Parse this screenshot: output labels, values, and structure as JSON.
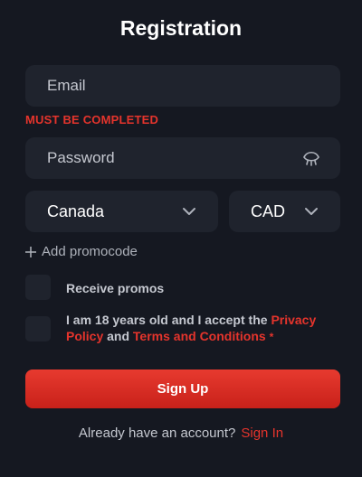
{
  "form": {
    "title": "Registration",
    "email_placeholder": "Email",
    "email_error": "MUST BE COMPLETED",
    "password_placeholder": "Password",
    "country_value": "Canada",
    "currency_value": "CAD",
    "add_promocode": "Add promocode",
    "receive_promos": "Receive promos",
    "terms_prefix": "I am 18 years old and I accept the",
    "privacy_link": "Privacy Policy",
    "terms_and": "and",
    "terms_link": "Terms and Conditions",
    "required_mark": "*",
    "signup_label": "Sign Up",
    "have_account": "Already have an account?",
    "signin_link": "Sign In"
  },
  "colors": {
    "background": "#151821",
    "field": "#1f232d",
    "accent": "#e5342c",
    "text_muted": "#c5c8d0"
  },
  "icons": [
    "eye-icon",
    "chevron-down-icon",
    "plus-icon"
  ]
}
